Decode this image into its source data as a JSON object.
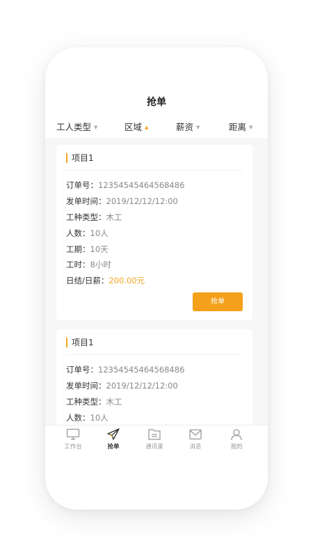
{
  "header": {
    "title": "抢单"
  },
  "filters": [
    {
      "label": "工人类型",
      "state": "collapsed"
    },
    {
      "label": "区域",
      "state": "expanded"
    },
    {
      "label": "薪资",
      "state": "collapsed"
    },
    {
      "label": "距离",
      "state": "collapsed"
    }
  ],
  "labels": {
    "order_no": "订单号：",
    "post_time": "发单时间：",
    "work_type": "工种类型：",
    "headcount": "人数：",
    "period": "工期：",
    "hours": "工时：",
    "pay": "日结/日薪："
  },
  "cards": [
    {
      "title": "项目1",
      "order_no": "12354545464568486",
      "post_time": "2019/12/12/12:00",
      "work_type": "木工",
      "headcount": "10人",
      "period": "10天",
      "hours": "8小时",
      "pay": "200.00元",
      "button": "抢单"
    },
    {
      "title": "项目1",
      "order_no": "12354545464568486",
      "post_time": "2019/12/12/12:00",
      "work_type": "木工",
      "headcount": "10人"
    }
  ],
  "tabbar": [
    {
      "label": "工作台",
      "icon": "monitor-icon",
      "active": false
    },
    {
      "label": "抢单",
      "icon": "paper-plane-icon",
      "active": true
    },
    {
      "label": "通讯录",
      "icon": "folder-icon",
      "active": false
    },
    {
      "label": "消息",
      "icon": "envelope-icon",
      "active": false
    },
    {
      "label": "我的",
      "icon": "person-icon",
      "active": false
    }
  ],
  "colors": {
    "accent": "#f5a623",
    "button": "#f5a01a",
    "list_background": "#f7f7f7"
  }
}
